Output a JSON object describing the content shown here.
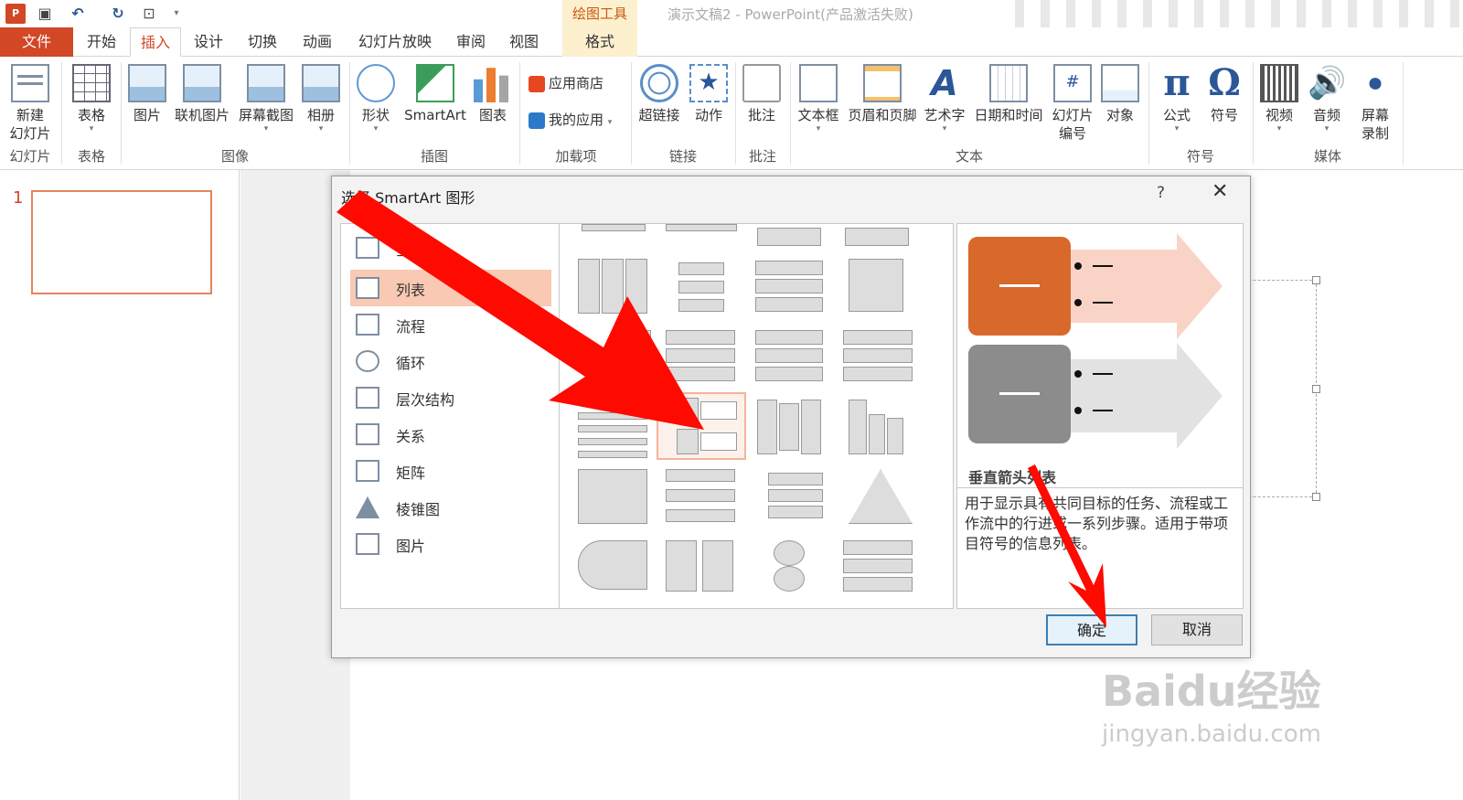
{
  "title_bar": {
    "app_icon": "powerpoint-icon",
    "context_tab_label": "绘图工具",
    "window_title": "演示文稿2 - PowerPoint(产品激活失败)"
  },
  "tabs": [
    {
      "label": "文件"
    },
    {
      "label": "开始"
    },
    {
      "label": "插入"
    },
    {
      "label": "设计"
    },
    {
      "label": "切换"
    },
    {
      "label": "动画"
    },
    {
      "label": "幻灯片放映"
    },
    {
      "label": "审阅"
    },
    {
      "label": "视图"
    },
    {
      "label": "格式"
    }
  ],
  "ribbon": {
    "new_slide": "新建",
    "new_slide_2": "幻灯片",
    "table": "表格",
    "picture": "图片",
    "online_picture": "联机图片",
    "screenshot": "屏幕截图",
    "album": "相册",
    "shapes": "形状",
    "smartart": "SmartArt",
    "chart": "图表",
    "store": "应用商店",
    "my_apps": "我的应用",
    "hyperlink": "超链接",
    "action": "动作",
    "comment": "批注",
    "textbox": "文本框",
    "header_footer": "页眉和页脚",
    "wordart": "艺术字",
    "datetime": "日期和时间",
    "slide_number": "幻灯片",
    "slide_number_2": "编号",
    "object": "对象",
    "equation": "公式",
    "symbol": "符号",
    "video": "视频",
    "audio": "音频",
    "screen_rec": "屏幕",
    "screen_rec_2": "录制",
    "wordart_glyph": "A",
    "slide_number_glyph": "#",
    "equation_glyph": "π",
    "symbol_glyph": "Ω",
    "groups": {
      "slides": "幻灯片",
      "tables": "表格",
      "images": "图像",
      "illustrations": "插图",
      "addins": "加载项",
      "links": "链接",
      "comments": "批注",
      "text": "文本",
      "symbols": "符号",
      "media": "媒体"
    }
  },
  "thumbnails": {
    "slide_number": "1"
  },
  "dialog": {
    "title": "选择 SmartArt 图形",
    "help": "?",
    "close": "✕",
    "categories": [
      {
        "label": "全部",
        "icon": "all-icon"
      },
      {
        "label": "列表",
        "icon": "list-icon"
      },
      {
        "label": "流程",
        "icon": "process-icon"
      },
      {
        "label": "循环",
        "icon": "cycle-icon"
      },
      {
        "label": "层次结构",
        "icon": "hierarchy-icon"
      },
      {
        "label": "关系",
        "icon": "relationship-icon"
      },
      {
        "label": "矩阵",
        "icon": "matrix-icon"
      },
      {
        "label": "棱锥图",
        "icon": "pyramid-icon"
      },
      {
        "label": "图片",
        "icon": "picture-icon"
      }
    ],
    "preview": {
      "name": "垂直箭头列表",
      "description": "用于显示具有共同目标的任务、流程或工作流中的行进或一系列步骤。适用于带项目符号的信息列表。"
    },
    "ok": "确定",
    "cancel": "取消",
    "scroll_up": "▲",
    "scroll_down": "▼"
  },
  "watermark": {
    "brand": "Baidu经验",
    "url": "jingyan.baidu.com"
  },
  "colors": {
    "accent": "#d24726",
    "selection": "#f9c9b3",
    "arrow": "#ff0a00"
  }
}
